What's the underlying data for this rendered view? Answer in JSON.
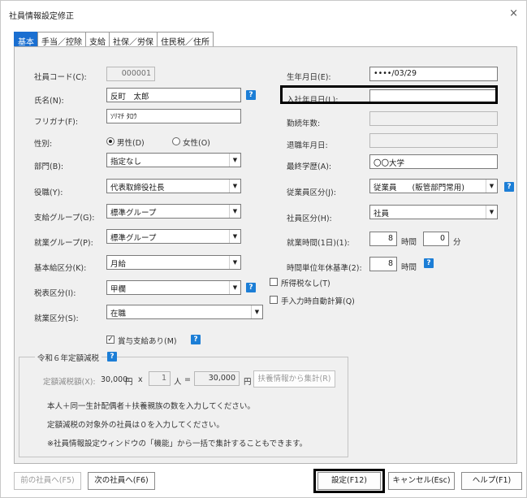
{
  "window": {
    "title": "社員情報設定修正",
    "close_icon": "×"
  },
  "tabs": [
    "基本",
    "手当／控除",
    "支給",
    "社保／労保",
    "住民税／住所"
  ],
  "left": {
    "employee_code_label": "社員コード(C):",
    "employee_code_value": "000001",
    "name_label": "氏名(N):",
    "name_value": "反町　太郎",
    "kana_label": "フリガナ(F):",
    "kana_value": "ｿﾘﾏﾁ ﾀﾛｳ",
    "gender_label": "性別:",
    "gender_male": "男性(D)",
    "gender_female": "女性(O)",
    "department_label": "部門(B):",
    "department_value": "指定なし",
    "position_label": "役職(Y):",
    "position_value": "代表取締役社長",
    "pay_group_label": "支給グループ(G):",
    "pay_group_value": "標準グループ",
    "work_group_label": "就業グループ(P):",
    "work_group_value": "標準グループ",
    "base_pay_label": "基本給区分(K):",
    "base_pay_value": "月給",
    "tax_label": "税表区分(I):",
    "tax_value": "甲欄",
    "employment_label": "就業区分(S):",
    "employment_value": "在職",
    "bonus_label": "賞与支給あり(M)"
  },
  "right": {
    "birth_label": "生年月日(E):",
    "birth_value": "••••/03/29",
    "join_label": "入社年月日(L):",
    "join_value": "",
    "years_label": "勤続年数:",
    "retire_label": "退職年月日:",
    "education_label": "最終学歴(A):",
    "education_value": "〇〇大学",
    "emp_class_label": "従業員区分(J):",
    "emp_class_value": "従業員　　(販管部門常用)",
    "staff_class_label": "社員区分(H):",
    "staff_class_value": "社員",
    "hours_label": "就業時間(1日)(1):",
    "hours_value": "8",
    "hours_unit": "時間",
    "minutes_value": "0",
    "minutes_unit": "分",
    "leave_label": "時間単位年休基準(2):",
    "leave_value": "8",
    "leave_unit": "時間",
    "no_income_tax_label": "所得税なし(T)",
    "manual_calc_label": "手入力時自動計算(Q)"
  },
  "reduction": {
    "title": "令和６年定額減税",
    "amount_label": "定額減税額(X):",
    "amount_value": "30,000",
    "yen": "円",
    "times": "x",
    "people_value": "1",
    "people_unit": "人",
    "equals": "=",
    "total_value": "30,000",
    "calc_button": "扶養情報から集計(R)",
    "note1": "本人＋同一生計配偶者＋扶養親族の数を入力してください。",
    "note2": "定額減税の対象外の社員は０を入力してください。",
    "note3": "※社員情報設定ウィンドウの「機能」から一括で集計することもできます。"
  },
  "footer": {
    "prev": "前の社員へ(F5)",
    "next": "次の社員へ(F6)",
    "ok": "設定(F12)",
    "cancel": "キャンセル(Esc)",
    "help": "ヘルプ(F1)"
  },
  "icons": {
    "help_icon": "?",
    "dropdown_icon": "▼"
  }
}
